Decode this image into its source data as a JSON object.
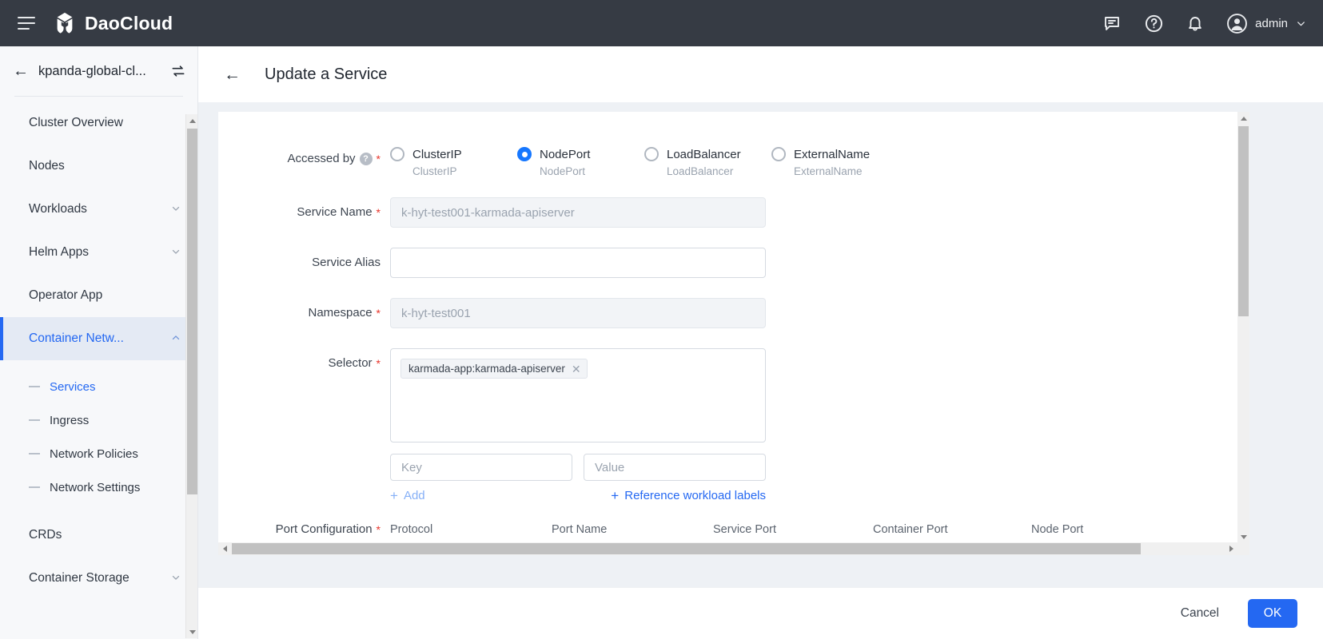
{
  "topbar": {
    "brand": "DaoCloud",
    "menu_icon": "hamburger-icon",
    "icons": [
      "chat-icon",
      "help-icon",
      "bell-icon"
    ],
    "user": "admin"
  },
  "sidebar": {
    "cluster_name": "kpanda-global-cl...",
    "items": [
      {
        "label": "Cluster Overview",
        "expandable": false,
        "active": false
      },
      {
        "label": "Nodes",
        "expandable": false,
        "active": false
      },
      {
        "label": "Workloads",
        "expandable": true,
        "active": false
      },
      {
        "label": "Helm Apps",
        "expandable": true,
        "active": false
      },
      {
        "label": "Operator App",
        "expandable": false,
        "active": false
      },
      {
        "label": "Container Netw...",
        "expandable": true,
        "active": true
      }
    ],
    "sub_items": [
      {
        "label": "Services",
        "selected": true
      },
      {
        "label": "Ingress",
        "selected": false
      },
      {
        "label": "Network Policies",
        "selected": false
      },
      {
        "label": "Network Settings",
        "selected": false
      }
    ],
    "items_after": [
      {
        "label": "CRDs",
        "expandable": false,
        "active": false
      },
      {
        "label": "Container Storage",
        "expandable": true,
        "active": false
      }
    ]
  },
  "page": {
    "title": "Update a Service",
    "back_icon": "arrow-left-icon"
  },
  "form": {
    "accessed_by": {
      "label": "Accessed by",
      "required": true,
      "help": "?",
      "options": [
        {
          "label": "ClusterIP",
          "sub": "ClusterIP",
          "selected": false
        },
        {
          "label": "NodePort",
          "sub": "NodePort",
          "selected": true
        },
        {
          "label": "LoadBalancer",
          "sub": "LoadBalancer",
          "selected": false
        },
        {
          "label": "ExternalName",
          "sub": "ExternalName",
          "selected": false
        }
      ]
    },
    "service_name": {
      "label": "Service Name",
      "required": true,
      "value": "k-hyt-test001-karmada-apiserver",
      "disabled": true
    },
    "service_alias": {
      "label": "Service Alias",
      "required": false,
      "value": "",
      "placeholder": ""
    },
    "namespace": {
      "label": "Namespace",
      "required": true,
      "value": "k-hyt-test001",
      "disabled": true
    },
    "selector": {
      "label": "Selector",
      "required": true,
      "chips": [
        "karmada-app:karmada-apiserver"
      ],
      "key_placeholder": "Key",
      "value_placeholder": "Value",
      "add_label": "Add",
      "reference_label": "Reference workload labels"
    },
    "port_configuration": {
      "label": "Port Configuration",
      "required": true,
      "columns": [
        "Protocol",
        "Port Name",
        "Service Port",
        "Container Port",
        "Node Port"
      ]
    }
  },
  "footer": {
    "cancel": "Cancel",
    "ok": "OK"
  },
  "colors": {
    "accent": "#2468F2",
    "radio_selected": "#1677ff",
    "topbar_bg": "#363B44",
    "required": "#e8342a"
  }
}
